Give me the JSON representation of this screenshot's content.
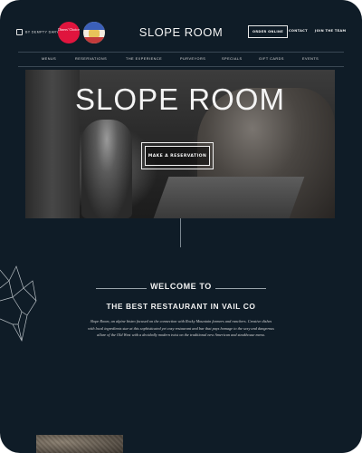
{
  "header": {
    "partner_label": "BY DEMPTY DARY",
    "badge_diners": "Diners' Choice",
    "brand": "SLOPE ROOM",
    "order_online": "ORDER ONLINE",
    "contact": "CONTACT",
    "join_team": "JOIN THE TEAM"
  },
  "nav": {
    "items": [
      "MENUS",
      "RESERVATIONS",
      "THE EXPERIENCE",
      "PURVEYORS",
      "SPECIALS",
      "GIFT CARDS",
      "EVENTS"
    ]
  },
  "hero": {
    "title": "SLOPE ROOM",
    "cta": "MAKE A RESERVATION"
  },
  "welcome": {
    "heading": "WELCOME TO",
    "subheading": "THE BEST RESTAURANT IN VAIL CO",
    "body": "Slope Room, an alpine bistro focused on the connection with Rocky Mountain farmers and ranchers. Creative dishes with local ingredients star at this sophisticated yet cozy restaurant and bar that pays homage to the sexy and dangerous allure of the Old West with a decidedly modern twist on the traditional new American and steakhouse menu."
  },
  "colors": {
    "background": "#0f1c27",
    "accent_red": "#e0153e",
    "text": "#f2f2f2"
  },
  "icons": [
    "wolf-geometric-icon",
    "partner-logo-icon",
    "diners-choice-badge",
    "opentable-badge"
  ]
}
